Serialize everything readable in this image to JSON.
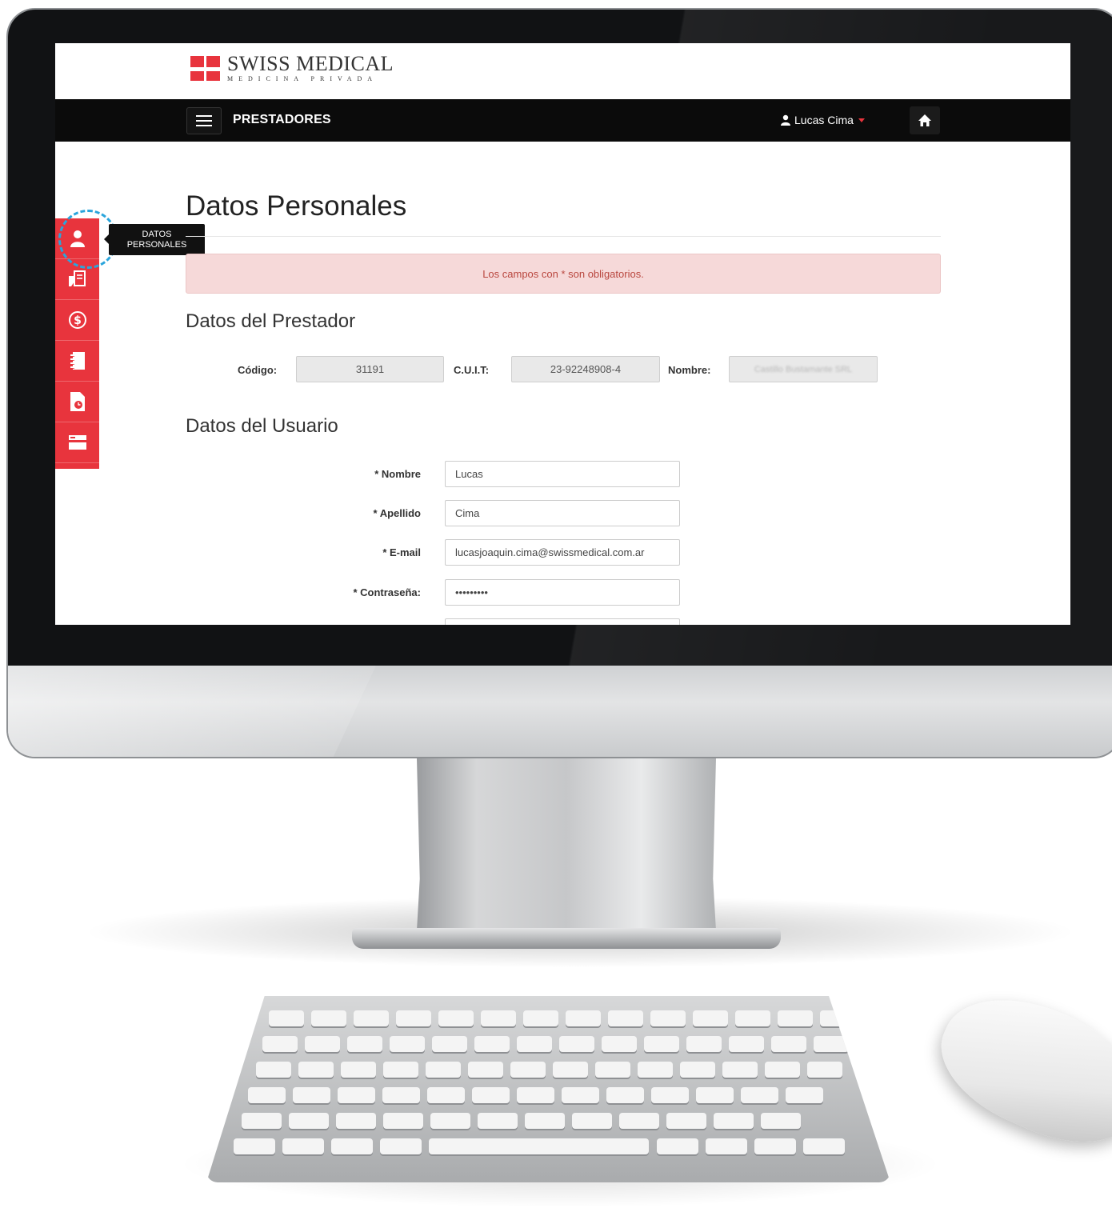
{
  "brand": {
    "name": "SWISS MEDICAL",
    "tagline": "MEDICINA PRIVADA",
    "color": "#e8343d"
  },
  "navbar": {
    "title": "PRESTADORES",
    "user_name": "Lucas Cima",
    "menu_icon": "hamburger-icon",
    "user_icon": "user-icon",
    "home_icon": "home-icon"
  },
  "sidebar": {
    "tooltip_line1": "DATOS",
    "tooltip_line2": "PERSONALES",
    "items": [
      {
        "icon": "user-icon"
      },
      {
        "icon": "prescription-icon"
      },
      {
        "icon": "dollar-icon"
      },
      {
        "icon": "notebook-icon"
      },
      {
        "icon": "document-clock-icon"
      },
      {
        "icon": "card-icon"
      }
    ],
    "highlight_color": "#2aa5dc"
  },
  "page": {
    "title": "Datos Personales",
    "alert": "Los campos con * son obligatorios."
  },
  "prestador": {
    "section_title": "Datos del Prestador",
    "codigo_label": "Código:",
    "codigo_value": "31191",
    "cuit_label": "C.U.I.T:",
    "cuit_value": "23-92248908-4",
    "nombre_label": "Nombre:",
    "nombre_value": "Castillo Bustamante SRL"
  },
  "usuario": {
    "section_title": "Datos del Usuario",
    "fields": [
      {
        "label": "* Nombre",
        "value": "Lucas"
      },
      {
        "label": "* Apellido",
        "value": "Cima"
      },
      {
        "label": "* E-mail",
        "value": "lucasjoaquin.cima@swissmedical.com.ar"
      },
      {
        "label": "* Contraseña:",
        "value": "•••••••••"
      }
    ]
  }
}
